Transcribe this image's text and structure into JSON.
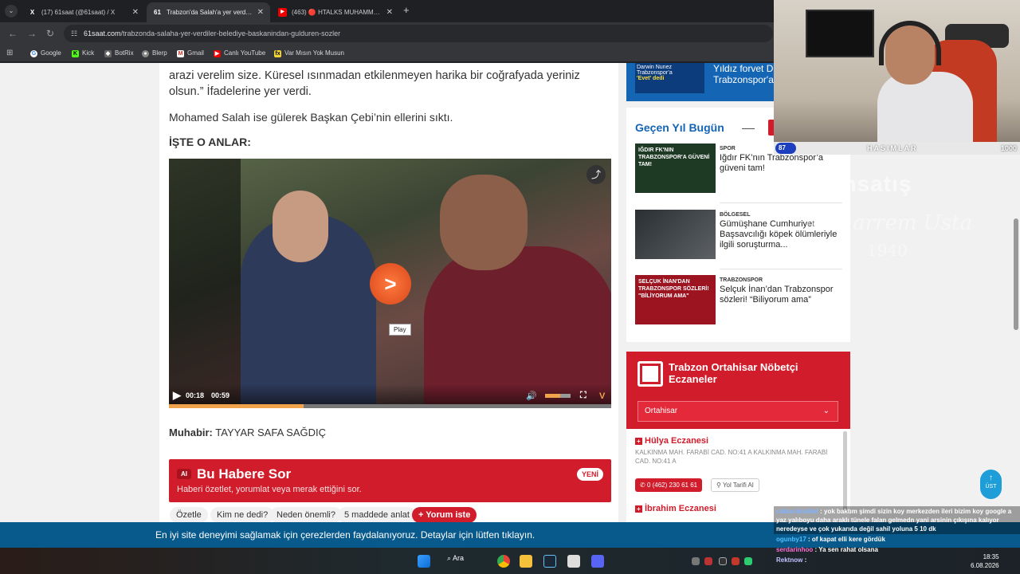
{
  "browser": {
    "tabs": [
      {
        "favicon": "X",
        "title": "(17) 61saat (@61saat) / X",
        "active": false
      },
      {
        "favicon": "61",
        "title": "Trabzon'da Salah'a yer verdiler",
        "active": true
      },
      {
        "favicon": "▶",
        "title": "(463) 🔴 HTALKS MUHAMMED",
        "active": false
      }
    ],
    "url_host": "61saat.com",
    "url_path": "/trabzonda-salaha-yer-verdiler-belediye-baskanindan-gulduren-sozler",
    "bookmarks": [
      "Google",
      "Kick",
      "BotRix",
      "Blerp",
      "Gmail",
      "Canlı YouTube",
      "Var Mısın Yok Musun"
    ]
  },
  "article": {
    "para1": "arazi verelim size. Küresel ısınmadan etkilenmeyen harika bir coğrafyada yeriniz olsun.” İfadelerine yer verdi.",
    "para2": "Mohamed Salah ise gülerek Başkan Çebi’nin ellerini sıktı.",
    "heading": "İŞTE O ANLAR:",
    "video": {
      "current_time": "00:18",
      "duration": "00:59",
      "progress": 0.305,
      "tooltip": "Play"
    },
    "reporter_label": "Muhabir:",
    "reporter_name": "TAYYAR SAFA SAĞDIÇ",
    "ai": {
      "badge": "AI",
      "title": "Bu Habere Sor",
      "subtitle": "Haberi özetlet, yorumlat veya merak ettiğini sor.",
      "new_badge": "YENİ",
      "chips": [
        "Özetle",
        "Kim ne dedi?",
        "Neden önemli?",
        "5 maddede anlat",
        "Yorum iste"
      ]
    }
  },
  "sidebar": {
    "top_thumb_text_a": "Darwin Nunez",
    "top_thumb_text_b": "Trabzonspor’a",
    "top_thumb_text_c": "'Evet' dedi",
    "top_title_line1": "Yıldız forvet D",
    "top_title_line2": "Trabzonspor'a",
    "gecen_yil_title": "Geçen Yıl Bugün",
    "items": [
      {
        "category": "SPOR",
        "title": "Iğdır FK’nın Trabzonspor’a güveni tam!",
        "thumb": "IĞDIR FK'NIN TRABZONSPOR'A GÜVENİ TAM!"
      },
      {
        "category": "BÖLGESEL",
        "title": "Gümüşhane Cumhuriyet Başsavcılığı köpek ölümleriyle ilgili soruşturma...",
        "thumb": ""
      },
      {
        "category": "TRABZONSPOR",
        "title": "Selçuk İnan’dan Trabzonspor sözleri! “Biliyorum ama”",
        "thumb": "SELÇUK İNAN'DAN TRABZONSPOR SÖZLERİ! \"BİLİYORUM AMA\""
      }
    ],
    "eczane": {
      "title": "Trabzon Ortahisar Nöbetçi Eczaneler",
      "district": "Ortahisar",
      "list": [
        {
          "name": "Hülya Eczanesi",
          "address": "KALKINMA MAH. FARABİ CAD. NO:41 A KALKINMA MAH. FARABİ CAD. NO:41 A",
          "phone": "0 (462) 230 61 61",
          "route": "Yol Tarifi Al"
        },
        {
          "name": "İbrahim Eczanesi",
          "address": "",
          "phone": "",
          "route": ""
        }
      ]
    },
    "ust_label": "ÜST"
  },
  "cookie_text": "En iyi site deneyimi sağlamak için çerezlerden faydalanıyoruz. Detaylar için lütfen tıklayın.",
  "taskbar": {
    "search": "Ara",
    "time": "18:35",
    "date": "6.08.2026"
  },
  "stream": {
    "level": "87",
    "bar_name": "HASIMLAR",
    "bar_max": "1000",
    "watermark1": "itemsatış",
    "watermark2": "Muharrem Usta",
    "watermark3": "1940",
    "chat": [
      {
        "user": "rakkasbisiklet",
        "msg": "yok baktım şimdi sizin koy merkezden ileri bizim koy google a yaz yalıboyu daha araklı tünele falan gelmedn yani arsinin çıkışına kalıyor neredeyse ve çok yukarıda değil sahil yoluna 5 10 dk"
      },
      {
        "user": "ogunby17",
        "msg": "of kapat elli kere gördük"
      },
      {
        "user": "serdarinhoo",
        "msg": "Ya sen rahat olsana"
      },
      {
        "user": "Rektnow",
        "msg": ""
      }
    ]
  }
}
